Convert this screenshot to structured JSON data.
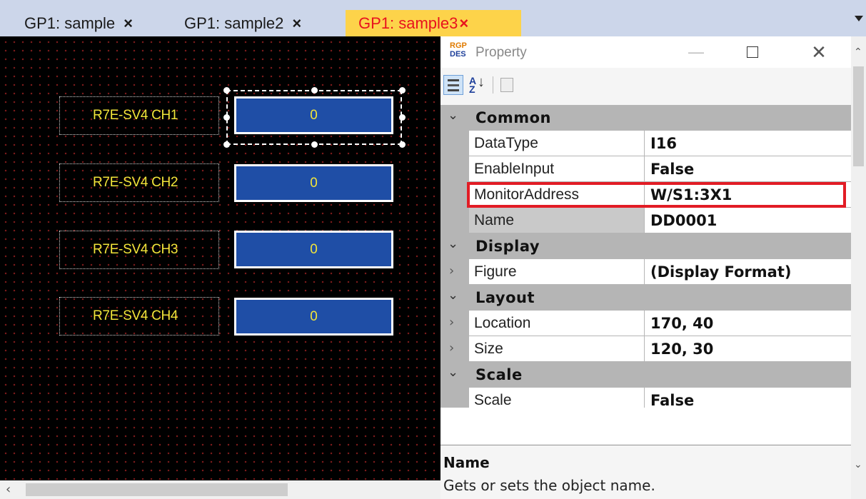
{
  "tabs": [
    {
      "label": "GP1: sample",
      "close": "×"
    },
    {
      "label": "GP1: sample2",
      "close": "×"
    },
    {
      "label": "GP1: sample3",
      "close": "×",
      "active": true
    }
  ],
  "canvas": {
    "items": [
      {
        "label": "R7E-SV4 CH1",
        "value": "0"
      },
      {
        "label": "R7E-SV4 CH2",
        "value": "0"
      },
      {
        "label": "R7E-SV4 CH3",
        "value": "0"
      },
      {
        "label": "R7E-SV4 CH4",
        "value": "0"
      }
    ]
  },
  "property": {
    "title": "Property",
    "logo_top": "RGP",
    "logo_bottom": "DES",
    "categories": {
      "common": "Common",
      "display": "Display",
      "layout": "Layout",
      "scale": "Scale"
    },
    "rows": {
      "datatype": {
        "name": "DataType",
        "value": "I16"
      },
      "enableinput": {
        "name": "EnableInput",
        "value": "False"
      },
      "monitoraddress": {
        "name": "MonitorAddress",
        "value": "W/S1:3X1"
      },
      "name": {
        "name": "Name",
        "value": "DD0001"
      },
      "figure": {
        "name": "Figure",
        "value": "(Display Format)"
      },
      "location": {
        "name": "Location",
        "value": "170, 40"
      },
      "size": {
        "name": "Size",
        "value": "120, 30"
      },
      "scale": {
        "name": "Scale",
        "value": "False"
      }
    },
    "description": {
      "title": "Name",
      "text": "Gets or sets the object name."
    }
  },
  "colors": {
    "active_tab_bg": "#fdd34a",
    "active_tab_text": "#e8121e",
    "canvas_bg": "#000000",
    "value_box_bg": "#1f4ea6",
    "label_text": "#f2e53a",
    "highlight": "#e21c25"
  }
}
